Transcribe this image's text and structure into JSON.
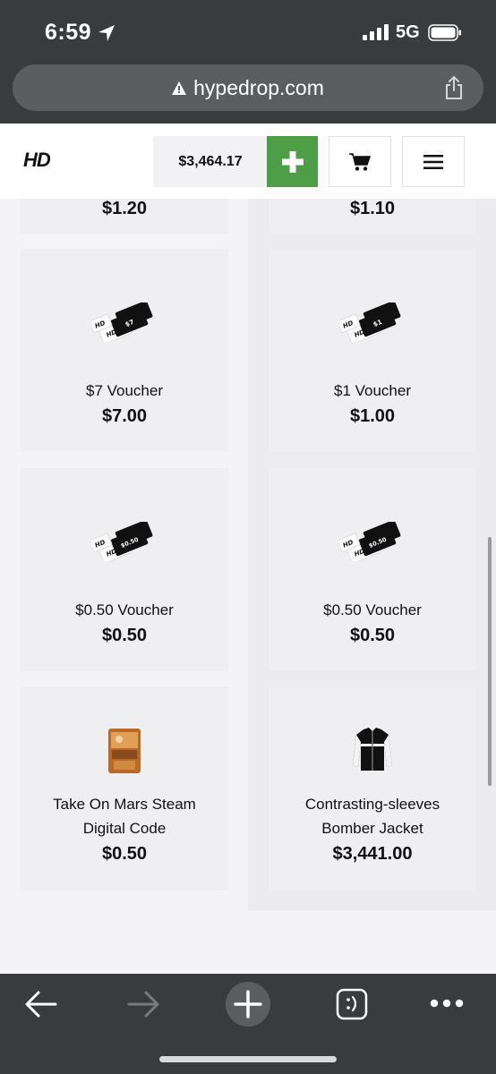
{
  "status_bar": {
    "time": "6:59",
    "network": "5G"
  },
  "browser": {
    "url": "hypedrop.com"
  },
  "header": {
    "logo": "HD",
    "balance": "$3,464.17"
  },
  "products": [
    {
      "name": "",
      "price": "$1.20",
      "partial": true
    },
    {
      "name": "",
      "price": "$1.10",
      "partial": true
    },
    {
      "name": "$7 Voucher",
      "price": "$7.00",
      "card_label": "$7"
    },
    {
      "name": "$1 Voucher",
      "price": "$1.00",
      "card_label": "$1"
    },
    {
      "name": "$0.50 Voucher",
      "price": "$0.50",
      "card_label": "$0.50"
    },
    {
      "name": "$0.50 Voucher",
      "price": "$0.50",
      "card_label": "$0.50"
    },
    {
      "name_line1": "Take On Mars Steam",
      "name_line2": "Digital Code",
      "price": "$0.50"
    },
    {
      "name_line1": "Contrasting-sleeves",
      "name_line2": "Bomber Jacket",
      "price": "$3,441.00"
    }
  ],
  "voucher_brand": "HD",
  "colors": {
    "accent_green": "#4e9d47",
    "browser_chrome": "#3a3b3d",
    "card_bg": "#efeff1"
  },
  "icons": {
    "location": "location-arrow-icon",
    "signal": "signal-icon",
    "battery": "battery-icon",
    "warning": "warning-icon",
    "share": "share-icon",
    "plus": "plus-icon",
    "cart": "cart-icon",
    "menu": "hamburger-menu-icon",
    "back": "back-arrow-icon",
    "forward": "forward-arrow-icon",
    "new_tab": "new-tab-plus-icon",
    "tabs": "tabs-icon",
    "more": "more-dots-icon"
  }
}
